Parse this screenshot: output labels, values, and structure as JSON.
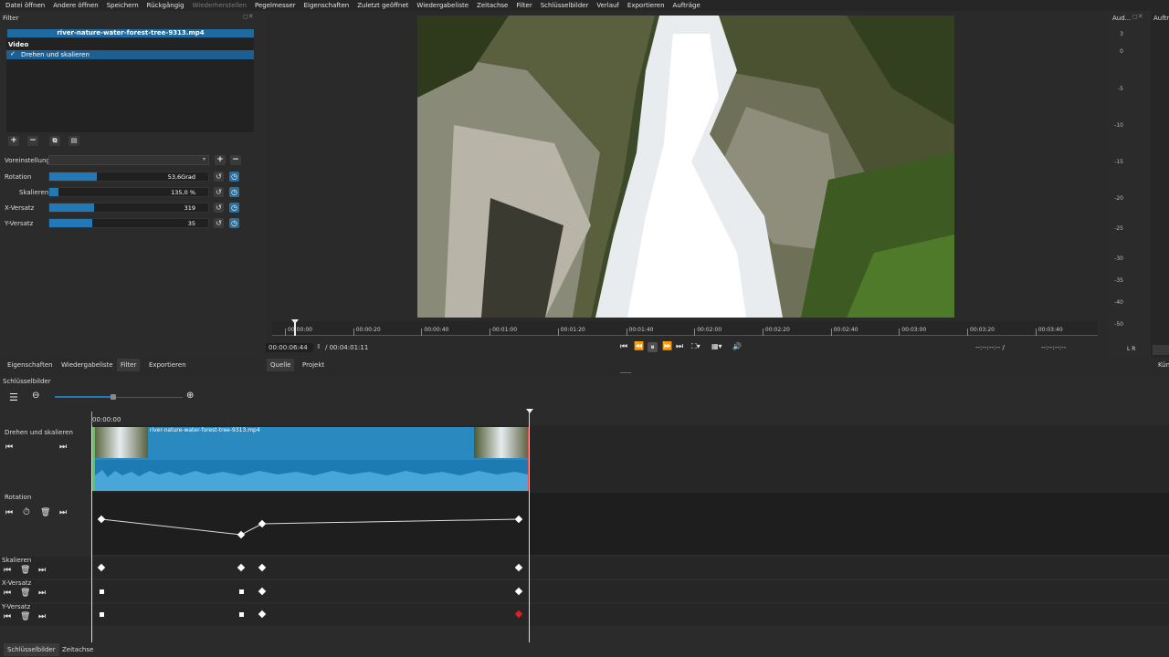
{
  "menu": [
    "Datei öffnen",
    "Andere öffnen",
    "Speichern",
    "Rückgängig",
    "Wiederherstellen",
    "Pegelmesser",
    "Eigenschaften",
    "Zuletzt geöffnet",
    "Wiedergabeliste",
    "Zeitachse",
    "Filter",
    "Schlüsselbilder",
    "Verlauf",
    "Exportieren",
    "Aufträge"
  ],
  "filter_panel": {
    "title": "Filter",
    "clip_name": "river-nature-water-forest-tree-9313.mp4",
    "category": "Video",
    "selected_filter": "Drehen und skalieren",
    "preset_label": "Voreinstellung",
    "params": [
      {
        "label": "Rotation",
        "value": "53,6Grad",
        "fill": 0.3
      },
      {
        "label": "Skalieren",
        "value": "135,0 %",
        "fill": 0.06
      },
      {
        "label": "X-Versatz",
        "value": "319",
        "fill": 0.28
      },
      {
        "label": "Y-Versatz",
        "value": "35",
        "fill": 0.27
      }
    ]
  },
  "meter": {
    "title": "Aud...",
    "title2": "Aufträ",
    "scale": [
      "3",
      "0",
      "-5",
      "-10",
      "-15",
      "-20",
      "-25",
      "-30",
      "-35",
      "-40",
      "-50"
    ],
    "lr": "L  R",
    "bottom": "Kün"
  },
  "player": {
    "ruler": [
      "00:00:00",
      "00:00:20",
      "00:00:40",
      "00:01:00",
      "00:01:20",
      "00:01:40",
      "00:02:00",
      "00:02:20",
      "00:02:40",
      "00:03:00",
      "00:03:20",
      "00:03:40"
    ],
    "current_time": "00:00:06:44",
    "total_time": "/ 00:04:01:11",
    "in_point": "--:--:--:-- /",
    "out_point": "--:--:--:--",
    "tab_source": "Quelle",
    "tab_project": "Projekt"
  },
  "left_tabs": [
    "Eigenschaften",
    "Wiedergabeliste",
    "Filter",
    "Exportieren"
  ],
  "keyframes": {
    "title": "Schlüsselbilder",
    "time": "00:00:00",
    "clip_track": "Drehen und skalieren",
    "clip_label": "river-nature-water-forest-tree-9313.mp4",
    "tracks": [
      "Rotation",
      "Skalieren",
      "X-Versatz",
      "Y-Versatz"
    ]
  },
  "bottom_tabs": [
    "Schlüsselbilder",
    "Zeitachse"
  ],
  "colors": {
    "accent": "#2279b6",
    "clip": "#2a8ac0",
    "playhead": "#ff3b3b"
  }
}
